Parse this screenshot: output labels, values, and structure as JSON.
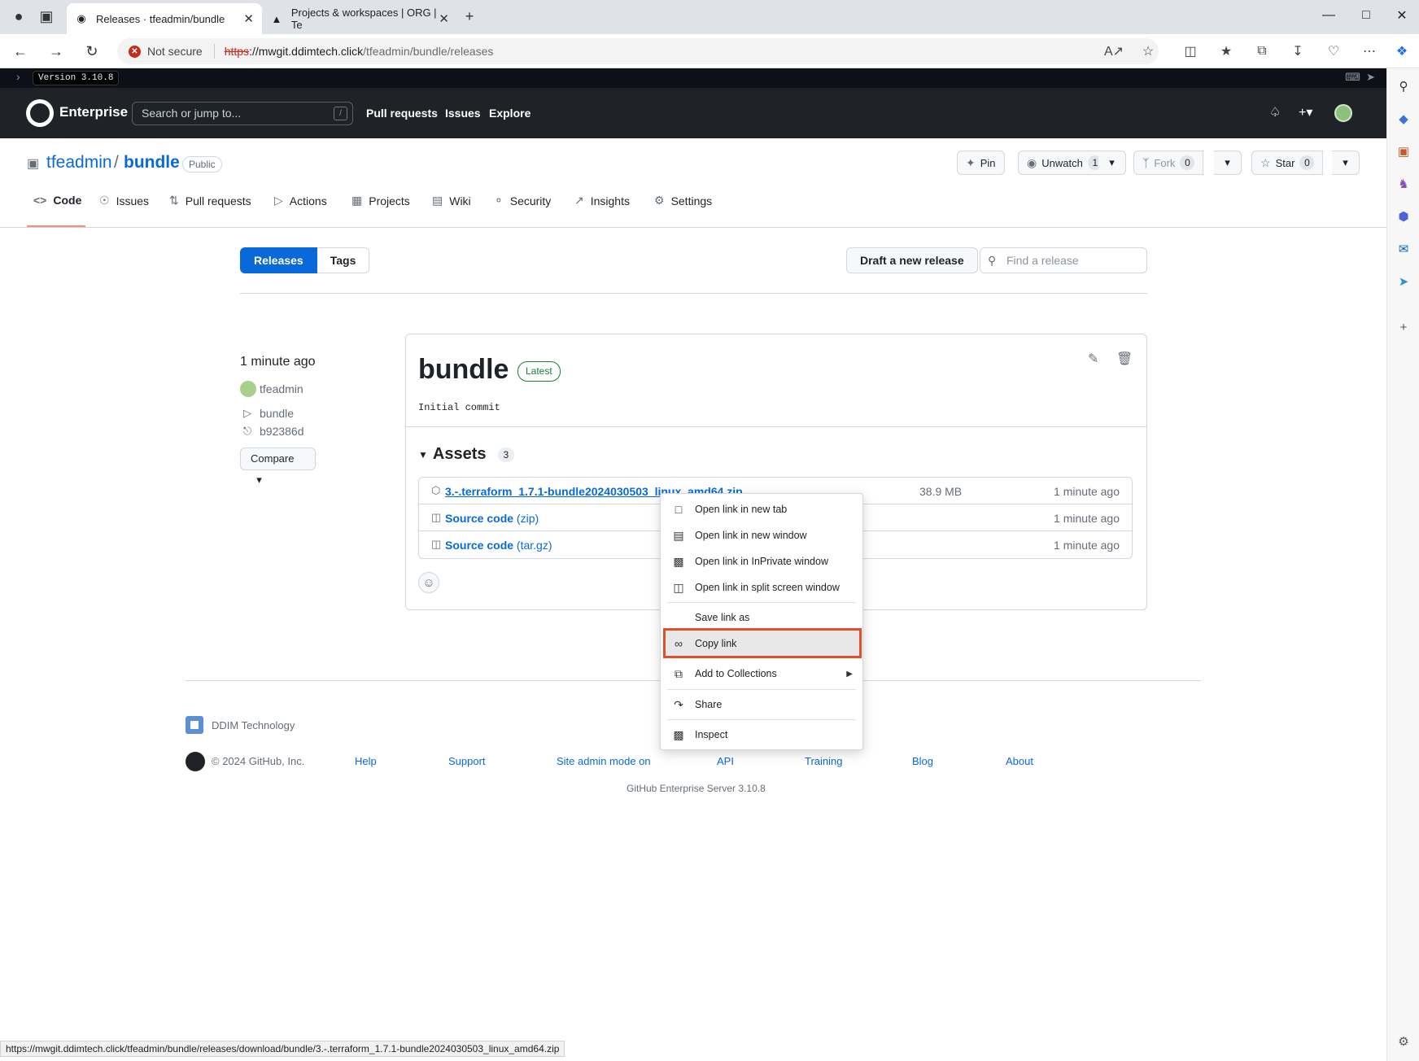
{
  "browser": {
    "tabs": [
      {
        "title": "Releases · tfeadmin/bundle",
        "active": true
      },
      {
        "title": "Projects & workspaces | ORG | Te",
        "active": false
      }
    ],
    "security_label": "Not secure",
    "url_scheme": "https",
    "url_host": "://mwgit.ddimtech.click",
    "url_path": "/tfeadmin/bundle/releases",
    "status_url": "https://mwgit.ddimtech.click/tfeadmin/bundle/releases/download/bundle/3.-.terraform_1.7.1-bundle2024030503_linux_amd64.zip"
  },
  "version_bar": {
    "label": "Version 3.10.8"
  },
  "header": {
    "brand": "Enterprise",
    "search_placeholder": "Search or jump to...",
    "search_hotkey": "/",
    "nav": [
      "Pull requests",
      "Issues",
      "Explore"
    ]
  },
  "repo": {
    "owner": "tfeadmin",
    "separator": "/",
    "name": "bundle",
    "visibility": "Public",
    "pin_label": "Pin",
    "watch_label": "Unwatch",
    "watch_count": "1",
    "fork_label": "Fork",
    "fork_count": "0",
    "star_label": "Star",
    "star_count": "0",
    "tabs": [
      "Code",
      "Issues",
      "Pull requests",
      "Actions",
      "Projects",
      "Wiki",
      "Security",
      "Insights",
      "Settings"
    ]
  },
  "releases_page": {
    "tab_releases": "Releases",
    "tab_tags": "Tags",
    "draft_button": "Draft a new release",
    "find_placeholder": "Find a release"
  },
  "release": {
    "time": "1 minute ago",
    "author": "tfeadmin",
    "tag": "bundle",
    "commit": "b92386d",
    "compare_label": "Compare",
    "title": "bundle",
    "badge": "Latest",
    "body": "Initial commit",
    "assets_label": "Assets",
    "assets_count": "3",
    "assets": [
      {
        "name": "3.-.terraform_1.7.1-bundle2024030503_linux_amd64.zip",
        "suffix": "",
        "size": "38.9 MB",
        "time": "1 minute ago"
      },
      {
        "name": "Source code",
        "suffix": " (zip)",
        "size": "",
        "time": "1 minute ago"
      },
      {
        "name": "Source code",
        "suffix": " (tar.gz)",
        "size": "",
        "time": "1 minute ago"
      }
    ]
  },
  "footer": {
    "brand": "DDIM Technology",
    "copyright": "© 2024 GitHub, Inc.",
    "links": [
      "Help",
      "Support",
      "Site admin mode on",
      "API",
      "Training",
      "Blog",
      "About"
    ],
    "server": "GitHub Enterprise Server 3.10.8"
  },
  "context_menu": {
    "items": [
      "Open link in new tab",
      "Open link in new window",
      "Open link in InPrivate window",
      "Open link in split screen window",
      "Save link as",
      "Copy link",
      "Add to Collections",
      "Share",
      "Inspect"
    ],
    "highlighted": "Copy link",
    "highlight_color": "#e2502a"
  },
  "colors": {
    "link": "#0969da",
    "header_bg": "#1f2328",
    "primary_button": "#0969da",
    "success": "#1a7f37"
  }
}
